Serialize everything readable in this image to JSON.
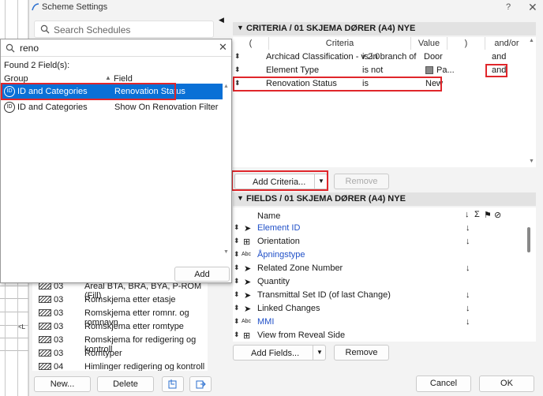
{
  "window": {
    "title": "Scheme Settings",
    "help": "?",
    "close": "✕"
  },
  "left": {
    "search_placeholder": "Search Schedules",
    "schedules": [
      {
        "code": "03",
        "name": "Areal BTA, BRA, BYA, P-ROM (Fill)"
      },
      {
        "code": "03",
        "name": "Romskjema etter etasje"
      },
      {
        "code": "03",
        "name": "Romskjema etter romnr. og romnavn"
      },
      {
        "code": "03",
        "name": "Romskjema etter romtype"
      },
      {
        "code": "03",
        "name": "Romskjema for redigering og kontroll"
      },
      {
        "code": "03",
        "name": "Romtyper"
      },
      {
        "code": "04",
        "name": "Himlinger redigering og kontroll"
      }
    ],
    "new_button": "New...",
    "delete_button": "Delete"
  },
  "popup": {
    "search_value": "reno",
    "found_text": "Found 2 Field(s):",
    "col_group": "Group",
    "col_field": "Field",
    "results": [
      {
        "group": "ID and Categories",
        "field": "Renovation Status",
        "selected": true
      },
      {
        "group": "ID and Categories",
        "field": "Show On Renovation Filter",
        "selected": false
      }
    ],
    "group_icon_text": "ID",
    "add_button": "Add"
  },
  "criteria": {
    "title": "CRITERIA / 01 SKJEMA DØRER (A4) NYE",
    "columns": {
      "open": "(",
      "criteria": "Criteria",
      "value": "Value",
      "close": ")",
      "andor": "and/or"
    },
    "rows": [
      {
        "criteria": "Archicad Classification - v 2.0",
        "op": "is in branch of",
        "value": "Door",
        "andor": "and"
      },
      {
        "criteria": "Element Type",
        "op": "is not",
        "value": "Pa...",
        "andor": "and"
      },
      {
        "criteria": "Renovation Status",
        "op": "is",
        "value": "New",
        "andor": ""
      }
    ],
    "add_button": "Add Criteria...",
    "remove_button": "Remove"
  },
  "fields": {
    "title": "FIELDS / 01 SKJEMA DØRER (A4) NYE",
    "name_header": "Name",
    "header_icons": [
      "↓",
      "Σ",
      "⚑",
      "⊘"
    ],
    "rows": [
      {
        "name": "Element ID",
        "blue": true,
        "icon": "cursor",
        "sort": "↓"
      },
      {
        "name": "Orientation",
        "blue": false,
        "icon": "grid",
        "sort": "↓"
      },
      {
        "name": "Åpningstype",
        "blue": true,
        "icon": "abc",
        "sort": ""
      },
      {
        "name": "Related Zone Number",
        "blue": false,
        "icon": "cursor",
        "sort": "↓"
      },
      {
        "name": "Quantity",
        "blue": false,
        "icon": "cursor",
        "sort": ""
      },
      {
        "name": "Transmittal Set ID (of last Change)",
        "blue": false,
        "icon": "cursor",
        "sort": "↓"
      },
      {
        "name": "Linked Changes",
        "blue": false,
        "icon": "cursor",
        "sort": "↓"
      },
      {
        "name": "MMI",
        "blue": true,
        "icon": "abc",
        "sort": "↓"
      },
      {
        "name": "View from Reveal Side",
        "blue": false,
        "icon": "grid",
        "sort": ""
      }
    ],
    "add_button": "Add Fields...",
    "remove_button": "Remove"
  },
  "footer": {
    "cancel": "Cancel",
    "ok": "OK"
  },
  "colors": {
    "selection": "#0a70d6",
    "highlight_red": "#e0262b",
    "link_blue": "#2050c8"
  }
}
